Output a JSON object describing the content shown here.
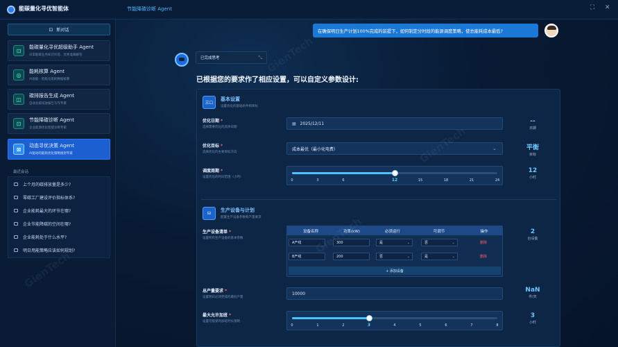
{
  "app": {
    "title": "能碳量化寻优智能体",
    "window_title": "节能降碳诊断 Agent",
    "controls": [
      "⛶",
      "✕"
    ]
  },
  "sidebar": {
    "new_chat": "新对话",
    "agents": [
      {
        "title": "能碳量化寻优超级助手 Agent",
        "sub": "日常能碳业务知识问答、优秀准确解答",
        "icon": "⊡",
        "active": false
      },
      {
        "title": "能耗核算 Agent",
        "sub": "AI助能 · 智能化能耗数据核算",
        "icon": "◎",
        "active": false
      },
      {
        "title": "碳排报告生成 Agent",
        "sub": "自动化碳排放报告写作专家",
        "icon": "◫",
        "active": false
      },
      {
        "title": "节能降碳诊断 Agent",
        "sub": "企业能源优化智能诊断专家",
        "icon": "⊡",
        "active": false
      },
      {
        "title": "动态寻优决策 Agent",
        "sub": "AI驱动的能耗优化策略规划专家",
        "icon": "⊠",
        "active": true
      }
    ],
    "recent_title": "最近会话",
    "conversations": [
      "上个月的碳排放量是多少?",
      "零碳工厂建设评价指标体系?",
      "企业能耗最大的环节在哪?",
      "企业节能降碳的空间在哪?",
      "企业能耗处于什么水平?",
      "明日用能策略应该如何规划?"
    ]
  },
  "chat": {
    "user_message": "在确保明日生产计划100%完成的前提下，如何制定分时段的能源调度策略，使总能耗成本最低?",
    "thinking_label": "已完成思考",
    "reply_text": "已根据您的要求作了相应设置，可以自定义参数设计:"
  },
  "basic": {
    "icon": "三☐",
    "title": "基本设置",
    "sub": "设置优化的基础条件和目标",
    "date": {
      "label": "优化日期",
      "sub": "选择需要优化的具体日期",
      "value": "2025/12/11",
      "summary": "--",
      "unit": "日期"
    },
    "target": {
      "label": "优化目标",
      "sub": "选择优化的主要目标方向",
      "value": "成本最优（最小化电费）",
      "summary": "平衡",
      "unit": "目标"
    },
    "cycle": {
      "label": "调度周期",
      "sub": "设置优化的时间范围（小时）",
      "ticks": [
        "0",
        "3",
        "6",
        "12",
        "15",
        "18",
        "21",
        "24"
      ],
      "value": 12,
      "max": 24,
      "summary": "12",
      "unit": "小时"
    }
  },
  "production": {
    "icon": "⊟",
    "title": "生产设备与计划",
    "sub": "配置生产设备参数和产量要求",
    "equipment": {
      "label": "生产设备清单",
      "sub": "设置所有生产设备的基本参数",
      "summary": "2",
      "unit": "台设备",
      "headers": [
        "设备名称",
        "功率(kW)",
        "必须运行",
        "可调节",
        "操作"
      ],
      "rows": [
        [
          "A产线",
          "300",
          "是",
          "否",
          "删除"
        ],
        [
          "B产线",
          "200",
          "否",
          "是",
          "删除"
        ]
      ],
      "add_label": "+ 添加设备"
    },
    "output": {
      "label": "总产量要求",
      "sub": "设置明日必须完成的最低产量",
      "value": "10000",
      "summary": "NaN",
      "unit": "件/天"
    },
    "overtime": {
      "label": "最大允许加班",
      "sub": "设置可接受的加班时长限制",
      "ticks": [
        "0",
        "1",
        "2",
        "3",
        "4",
        "5",
        "6",
        "7",
        "8"
      ],
      "value": 3,
      "max": 8,
      "summary": "3",
      "unit": "小时"
    }
  },
  "watermark": "GienTech"
}
